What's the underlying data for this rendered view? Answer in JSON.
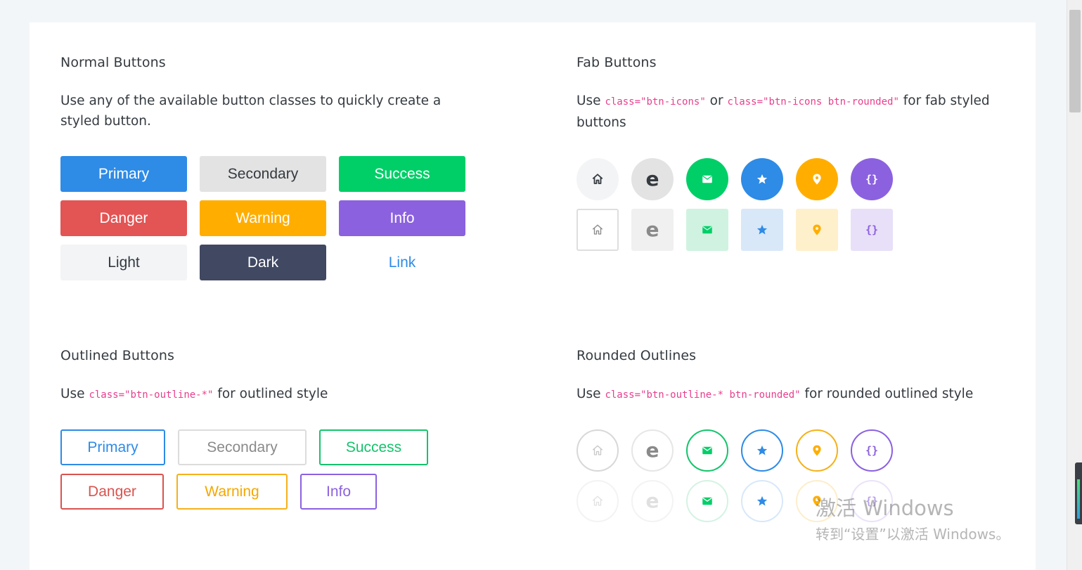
{
  "normal": {
    "title": "Normal Buttons",
    "desc": "Use any of the available button classes to quickly create a styled button.",
    "buttons": [
      "Primary",
      "Secondary",
      "Success",
      "Danger",
      "Warning",
      "Info",
      "Light",
      "Dark",
      "Link"
    ]
  },
  "fab": {
    "title": "Fab Buttons",
    "desc_prefix": "Use ",
    "code1": "class=\"btn-icons\"",
    "desc_mid": " or ",
    "code2": "class=\"btn-icons btn-rounded\"",
    "desc_suffix": " for fab styled buttons",
    "icons": [
      "home-icon",
      "edge-icon",
      "mail-icon",
      "star-icon",
      "location-pin-icon",
      "code-braces-icon"
    ],
    "code_glyph": "{}",
    "e_glyph": "e"
  },
  "outlined": {
    "title": "Outlined Buttons",
    "desc_prefix": "Use ",
    "code": "class=\"btn-outline-*\"",
    "desc_suffix": " for outlined style",
    "buttons": [
      "Primary",
      "Secondary",
      "Success",
      "Danger",
      "Warning",
      "Info"
    ]
  },
  "rounded": {
    "title": "Rounded Outlines",
    "desc_prefix": "Use ",
    "code": "class=\"btn-outline-* btn-rounded\"",
    "desc_suffix": " for rounded outlined style"
  },
  "watermark": {
    "line1": "激活 Windows",
    "line2": "转到“设置”以激活 Windows。"
  },
  "colors": {
    "primary": "#2e8be6",
    "secondary": "#e3e3e3",
    "success": "#00cf68",
    "danger": "#e35454",
    "warning": "#ffae00",
    "info": "#8b61e0",
    "light": "#f3f4f6",
    "dark": "#404862"
  }
}
